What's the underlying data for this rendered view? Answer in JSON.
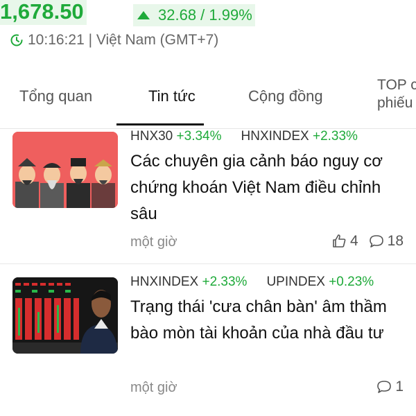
{
  "header": {
    "price": "1,678.50",
    "change": "32.68 / 1.99%",
    "time": "10:16:21 | Việt Nam (GMT+7)",
    "accent_color": "#1faa3a"
  },
  "tabs": [
    {
      "label": "Tổng quan"
    },
    {
      "label": "Tin tức"
    },
    {
      "label": "Cộng đồng"
    },
    {
      "label": "TOP cổ phiếu"
    }
  ],
  "articles": [
    {
      "tags": [
        {
          "name": "HNX30",
          "change": "+3.34%"
        },
        {
          "name": "HNXINDEX",
          "change": "+2.33%"
        }
      ],
      "title": "Các chuyên gia cảnh báo nguy cơ chứng khoán Việt Nam điều chỉnh sâu",
      "time": "một giờ",
      "likes": "4",
      "comments": "18"
    },
    {
      "tags": [
        {
          "name": "HNXINDEX",
          "change": "+2.33%"
        },
        {
          "name": "UPINDEX",
          "change": "+0.23%"
        }
      ],
      "title": "Trạng thái 'cưa chân bàn' âm thầm bào mòn tài khoản của nhà đầu tư",
      "time": "một giờ",
      "comments": "1"
    }
  ]
}
